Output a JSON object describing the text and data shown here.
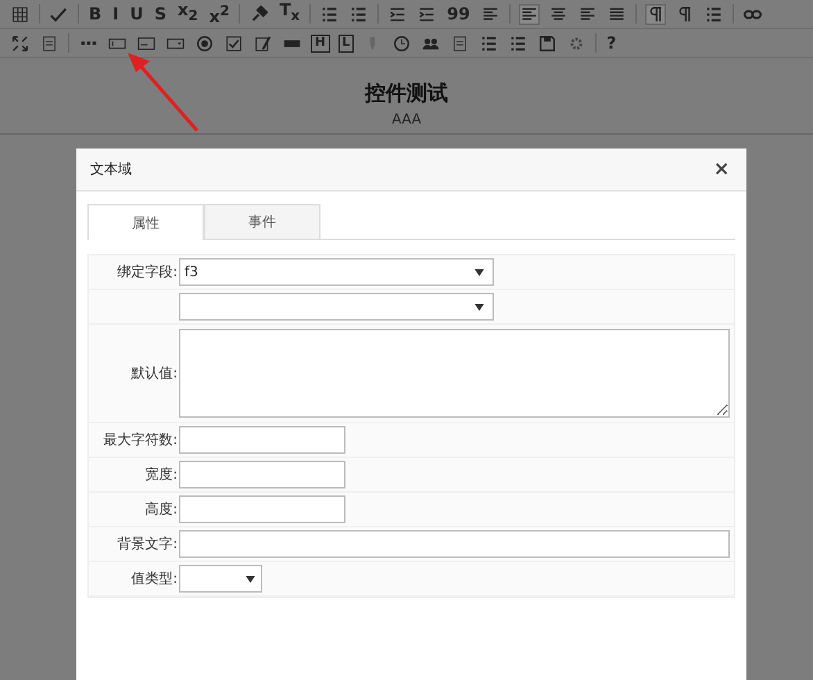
{
  "toolbar": {
    "row_1_texts": [
      "B",
      "I",
      "U",
      "S",
      "x$_{2}$",
      "x$^{2}$",
      "T$_{x}$",
      "99"
    ],
    "row_2_texts": [
      "H",
      "L",
      "?"
    ]
  },
  "document": {
    "title": "控件测试",
    "subtitle": "AAA"
  },
  "dialog": {
    "title": "文本域",
    "close": "×",
    "tabs": [
      {
        "label": "属性",
        "selected": true
      },
      {
        "label": "事件",
        "selected": false
      }
    ],
    "fields": [
      {
        "kind": "select",
        "label": "绑定字段:",
        "value": "f3"
      },
      {
        "kind": "select"
      },
      {
        "kind": "textarea",
        "label": "默认值:"
      },
      {
        "kind": "input",
        "label": "最大字符数:"
      },
      {
        "kind": "input",
        "label": "宽度:"
      },
      {
        "kind": "input",
        "label": "高度:"
      },
      {
        "kind": "wide-input",
        "label": "背景文字:"
      },
      {
        "kind": "small-select",
        "label": "值类型:"
      }
    ]
  }
}
